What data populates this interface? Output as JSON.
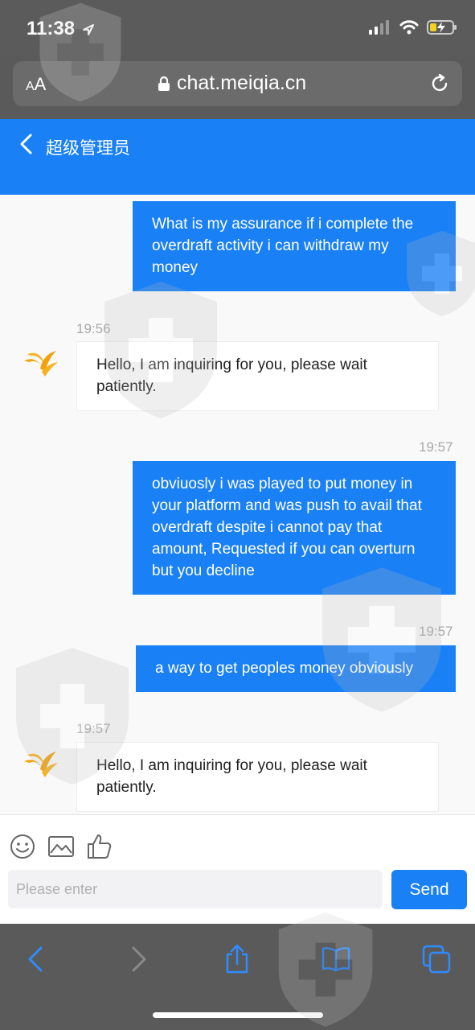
{
  "status_bar": {
    "time": "11:38"
  },
  "browser": {
    "text_size_label_small": "A",
    "text_size_label_large": "A",
    "url": "chat.meiqia.cn"
  },
  "chat_header": {
    "title": "超级管理员"
  },
  "messages": [
    {
      "from": "user",
      "text": "What is my assurance if i complete the overdraft activity i can withdraw my money"
    },
    {
      "from": "agent",
      "time": "19:56",
      "text": "Hello, I am inquiring for you, please wait patiently."
    },
    {
      "from": "user",
      "time": "19:57",
      "text": "obviuosly i was played to put money in your platform and was push to avail that overdraft despite i cannot pay that amount, Requested if you can overturn but you decline"
    },
    {
      "from": "user",
      "time": "19:57",
      "text": "a way to get peoples money obviously"
    },
    {
      "from": "agent",
      "time": "19:57",
      "text": "Hello, I am inquiring for you, please wait patiently."
    }
  ],
  "input": {
    "placeholder": "Please enter",
    "send_label": "Send"
  },
  "icons": [
    "emoji-icon",
    "image-icon",
    "thumbs-up-icon",
    "back-icon",
    "forward-icon",
    "share-icon",
    "bookmarks-icon",
    "tabs-icon"
  ],
  "colors": {
    "accent": "#1a80f5",
    "browser_chrome": "#5a5a5a"
  }
}
